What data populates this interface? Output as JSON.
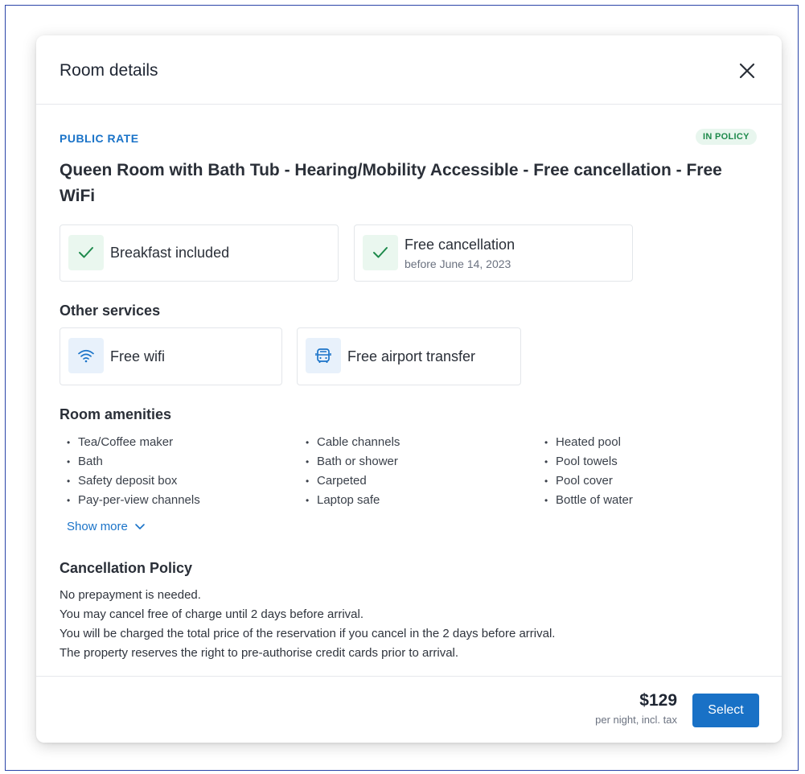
{
  "modal": {
    "title": "Room details",
    "rate_label": "PUBLIC RATE",
    "policy_badge": "IN POLICY",
    "room_title": "Queen Room with Bath Tub - Hearing/Mobility Accessible - Free cancellation - Free WiFi"
  },
  "highlights": [
    {
      "icon": "check-icon",
      "label": "Breakfast included"
    },
    {
      "icon": "check-icon",
      "label": "Free cancellation",
      "sub": "before June 14, 2023"
    }
  ],
  "other_services": {
    "title": "Other services",
    "items": [
      {
        "icon": "wifi-icon",
        "label": "Free wifi"
      },
      {
        "icon": "shuttle-icon",
        "label": "Free airport transfer"
      }
    ]
  },
  "amenities": {
    "title": "Room amenities",
    "columns": [
      [
        "Tea/Coffee maker",
        "Bath",
        "Safety deposit box",
        "Pay-per-view channels"
      ],
      [
        "Cable channels",
        "Bath or shower",
        "Carpeted",
        "Laptop safe"
      ],
      [
        "Heated pool",
        "Pool towels",
        "Pool cover",
        "Bottle of water"
      ]
    ],
    "show_more": "Show more"
  },
  "cancellation": {
    "title": "Cancellation Policy",
    "lines": [
      "No prepayment is needed.",
      "You may cancel free of charge until 2 days before arrival.",
      "You will be charged the total price of the reservation if you cancel in the 2 days before arrival.",
      "The property reserves the right to pre-authorise credit cards prior to arrival."
    ]
  },
  "footer": {
    "price": "$129",
    "price_note": "per night, incl. tax",
    "select_label": "Select"
  },
  "colors": {
    "accent": "#1971c6",
    "success": "#1e8a4c",
    "frame": "#2a44a8"
  }
}
